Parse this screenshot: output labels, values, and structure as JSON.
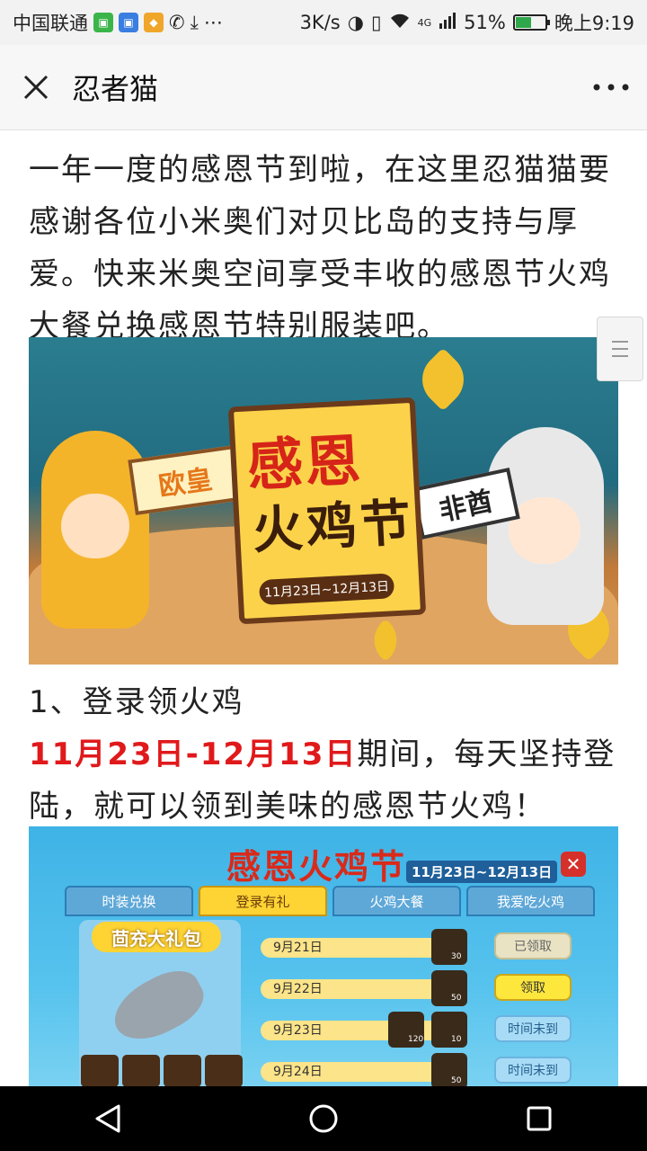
{
  "status_bar": {
    "carrier": "中国联通",
    "net_speed": "3K/s",
    "network_type": "4G",
    "battery_percent": "51%",
    "battery_level": 0.51,
    "time": "晚上9:19",
    "icons": [
      "app-icon-green",
      "app-icon-blue",
      "app-icon-100",
      "missed-call-icon",
      "download-icon",
      "more-dots-icon",
      "hd-icon",
      "vibrate-icon",
      "wifi-icon",
      "signal-icon",
      "battery-icon"
    ]
  },
  "title_bar": {
    "close_icon": "close-icon",
    "title": "忍者猫",
    "more_icon": "more-icon"
  },
  "article": {
    "intro": "一年一度的感恩节到啦，在这里忍猫猫要感谢各位小米奥们对贝比岛的支持与厚爱。快来米奥空间享受丰收的感恩节火鸡大餐兑换感恩节特别服装吧。",
    "banner": {
      "title_line1": "感恩",
      "title_line2": "火鸡节",
      "date": "11月23日~12月13日",
      "sign_left": "欧皇",
      "sign_right": "非酋"
    },
    "step1": "1、登录领火鸡",
    "para2_date": "11月23日-12月13日",
    "para2_rest": "期间，每天坚持登陆，就可以领到美味的感恩节火鸡！",
    "game": {
      "title": "感恩火鸡节",
      "date": "11月23日~12月13日",
      "close": "✕",
      "tabs": [
        "时装兑换",
        "登录有礼",
        "火鸡大餐",
        "我爱吃火鸡"
      ],
      "gift_title": "茴充大礼包",
      "rows": [
        {
          "day": "9月21日",
          "qty": "30",
          "button": "已领取"
        },
        {
          "day": "9月22日",
          "qty": "50",
          "button": "领取"
        },
        {
          "day": "9月23日",
          "qty_extra": "120",
          "qty": "10",
          "button": "时间未到"
        },
        {
          "day": "9月24日",
          "qty": "50",
          "button": "时间未到"
        }
      ]
    }
  },
  "nav_bar": {
    "back_icon": "back-icon",
    "home_icon": "home-icon",
    "recents_icon": "recents-icon"
  }
}
